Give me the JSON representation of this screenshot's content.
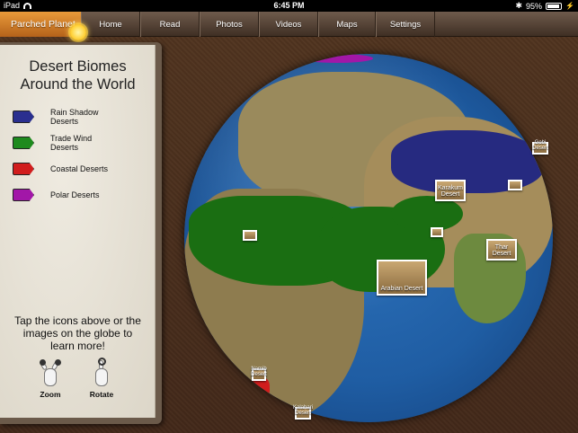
{
  "status": {
    "carrier": "iPad",
    "time": "6:45 PM",
    "battery": "95%"
  },
  "nav": {
    "brand": "Parched Planet",
    "tabs": [
      "Home",
      "Read",
      "Photos",
      "Videos",
      "Maps",
      "Settings"
    ]
  },
  "panel": {
    "title_line1": "Desert Biomes",
    "title_line2": "Around the World",
    "legend": [
      {
        "line1": "Rain Shadow",
        "line2": "Deserts",
        "color": "#2a2f8f"
      },
      {
        "line1": "Trade Wind",
        "line2": "Deserts",
        "color": "#1e8a1e"
      },
      {
        "line1": "Coastal Deserts",
        "line2": "",
        "color": "#d11d1d"
      },
      {
        "line1": "Polar Deserts",
        "line2": "",
        "color": "#a217a8"
      }
    ],
    "instruction_line1": "Tap the icons above or the",
    "instruction_line2": "images on the globe to",
    "instruction_line3": "learn more!",
    "zoom_label": "Zoom",
    "rotate_label": "Rotate"
  },
  "globe": {
    "colors": {
      "ocean": "#1f5da3",
      "trade_wind": "#1a6e12",
      "rain_shadow": "#262a80",
      "polar": "#a217a8"
    },
    "markers": {
      "karakum": "Karakum Desert",
      "arabian": "Arabian Desert",
      "thar": "Thar Desert",
      "gobi": "Gobi Desert",
      "namib": "Namib Desert",
      "kalahari": "Kalahari Desert"
    }
  }
}
